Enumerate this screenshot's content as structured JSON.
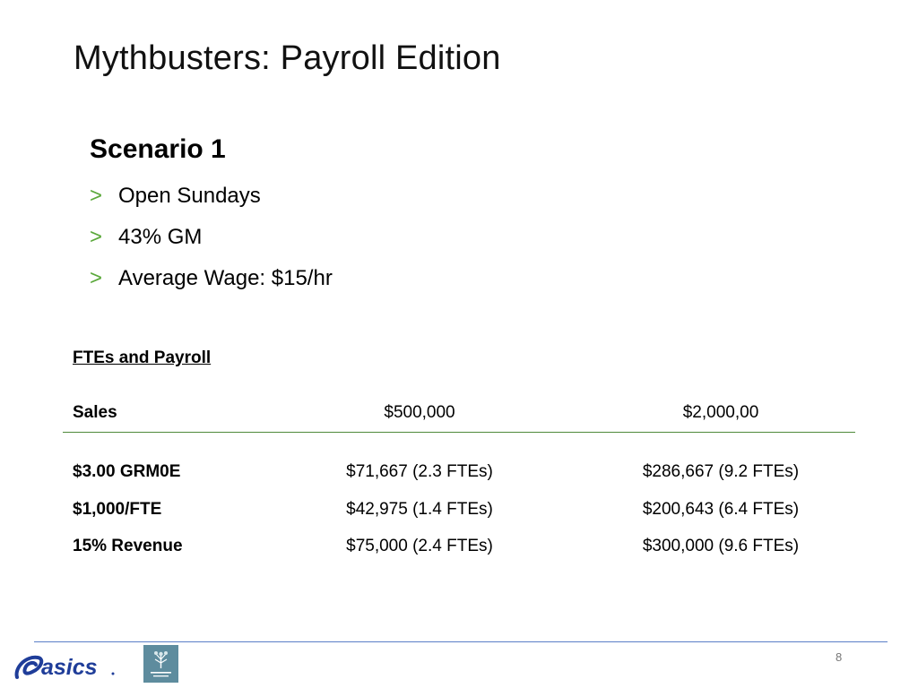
{
  "slide": {
    "title": "Mythbusters: Payroll Edition",
    "scenario_heading": "Scenario 1",
    "bullet_marker": ">",
    "bullets": [
      "Open Sundays",
      "43% GM",
      "Average Wage: $15/hr"
    ],
    "section_label": "FTEs and Payroll",
    "page_number": "8"
  },
  "table": {
    "header": [
      "Sales",
      "$500,000",
      "$2,000,00"
    ],
    "rows": [
      [
        "$3.00 GRM0E",
        "$71,667 (2.3 FTEs)",
        "$286,667 (9.2 FTEs)"
      ],
      [
        "$1,000/FTE",
        "$42,975 (1.4 FTEs)",
        "$200,643 (6.4 FTEs)"
      ],
      [
        "15% Revenue",
        "$75,000 (2.4 FTEs)",
        "$300,000 (9.6 FTEs)"
      ]
    ]
  },
  "logos": {
    "left": "asics-logo",
    "right": "consulting-firm-logo"
  },
  "colors": {
    "bullet_accent": "#5aa83a",
    "table_rule": "#4f8a3a",
    "footer_rule": "#5b7fc7",
    "asics_blue": "#1f3d99",
    "small_logo_bg": "#5e8c9e"
  }
}
